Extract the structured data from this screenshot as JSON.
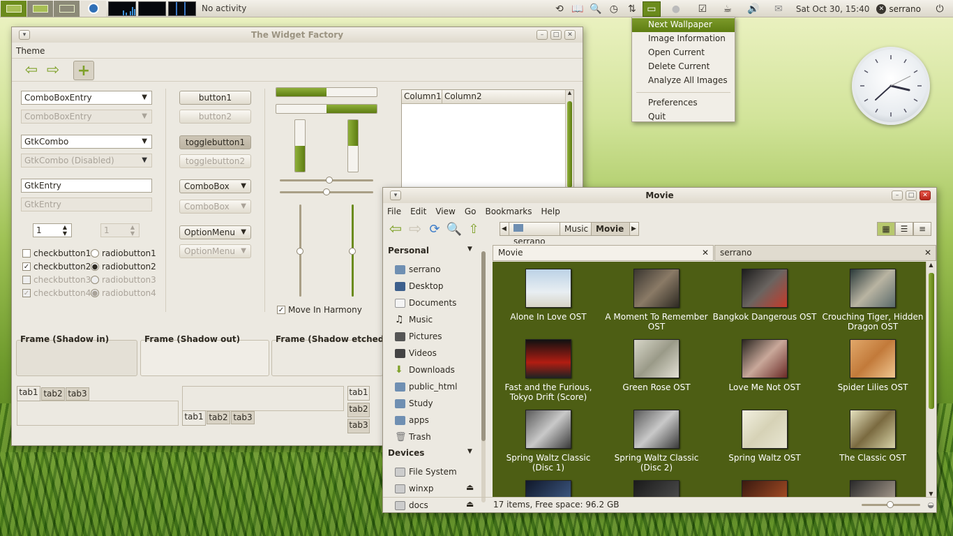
{
  "panel": {
    "activity": "No activity",
    "datetime": "Sat Oct 30, 15:40",
    "user": "serrano"
  },
  "wallpaper_menu": {
    "items": [
      "Next Wallpaper",
      "Image Information",
      "Open Current",
      "Delete Current",
      "Analyze All Images"
    ],
    "items2": [
      "Preferences",
      "Quit"
    ]
  },
  "widget_factory": {
    "title": "The Widget Factory",
    "menu_theme": "Theme",
    "combo_entry": "ComboBoxEntry",
    "combo_entry_dis": "ComboBoxEntry",
    "gtkcombo": "GtkCombo",
    "gtkcombo_dis": "GtkCombo (Disabled)",
    "gtkentry": "GtkEntry",
    "gtkentry_dis": "GtkEntry",
    "spin1": "1",
    "spin2": "1",
    "checks": [
      "checkbutton1",
      "checkbutton2",
      "checkbutton3",
      "checkbutton4"
    ],
    "radios": [
      "radiobutton1",
      "radiobutton2",
      "radiobutton3",
      "radiobutton4"
    ],
    "button1": "button1",
    "button2": "button2",
    "toggle1": "togglebutton1",
    "toggle2": "togglebutton2",
    "combobox": "ComboBox",
    "combobox_dis": "ComboBox",
    "optionmenu": "OptionMenu",
    "optionmenu_dis": "OptionMenu",
    "move_harmony": "Move In Harmony",
    "columns": [
      "Column1",
      "Column2"
    ],
    "frames": [
      "Frame (Shadow in)",
      "Frame (Shadow out)",
      "Frame (Shadow etched in)"
    ],
    "tabs": [
      "tab1",
      "tab2",
      "tab3"
    ],
    "hprogress": [
      0.5,
      0.5
    ],
    "vprogress": [
      0.5,
      0.5
    ]
  },
  "nautilus": {
    "title": "Movie",
    "menus": [
      "File",
      "Edit",
      "View",
      "Go",
      "Bookmarks",
      "Help"
    ],
    "breadcrumb": [
      "serrano",
      "Music",
      "Movie"
    ],
    "sidebar_personal": "Personal",
    "places": [
      "serrano",
      "Desktop",
      "Documents",
      "Music",
      "Pictures",
      "Videos",
      "Downloads",
      "public_html",
      "Study",
      "apps",
      "Trash"
    ],
    "sidebar_devices": "Devices",
    "devices": [
      "File System",
      "winxp",
      "docs"
    ],
    "tabs": [
      "Movie",
      "serrano"
    ],
    "items": [
      "Alone In Love OST",
      "A Moment To Remember OST",
      "Bangkok Dangerous OST",
      "Crouching Tiger, Hidden Dragon OST",
      "Fast and the Furious, Tokyo Drift (Score)",
      "Green Rose OST",
      "Love Me Not OST",
      "Spider Lilies OST",
      "Spring Waltz Classic (Disc 1)",
      "Spring Waltz Classic (Disc 2)",
      "Spring Waltz OST",
      "The Classic OST"
    ],
    "status": "17 items, Free space: 96.2 GB"
  }
}
